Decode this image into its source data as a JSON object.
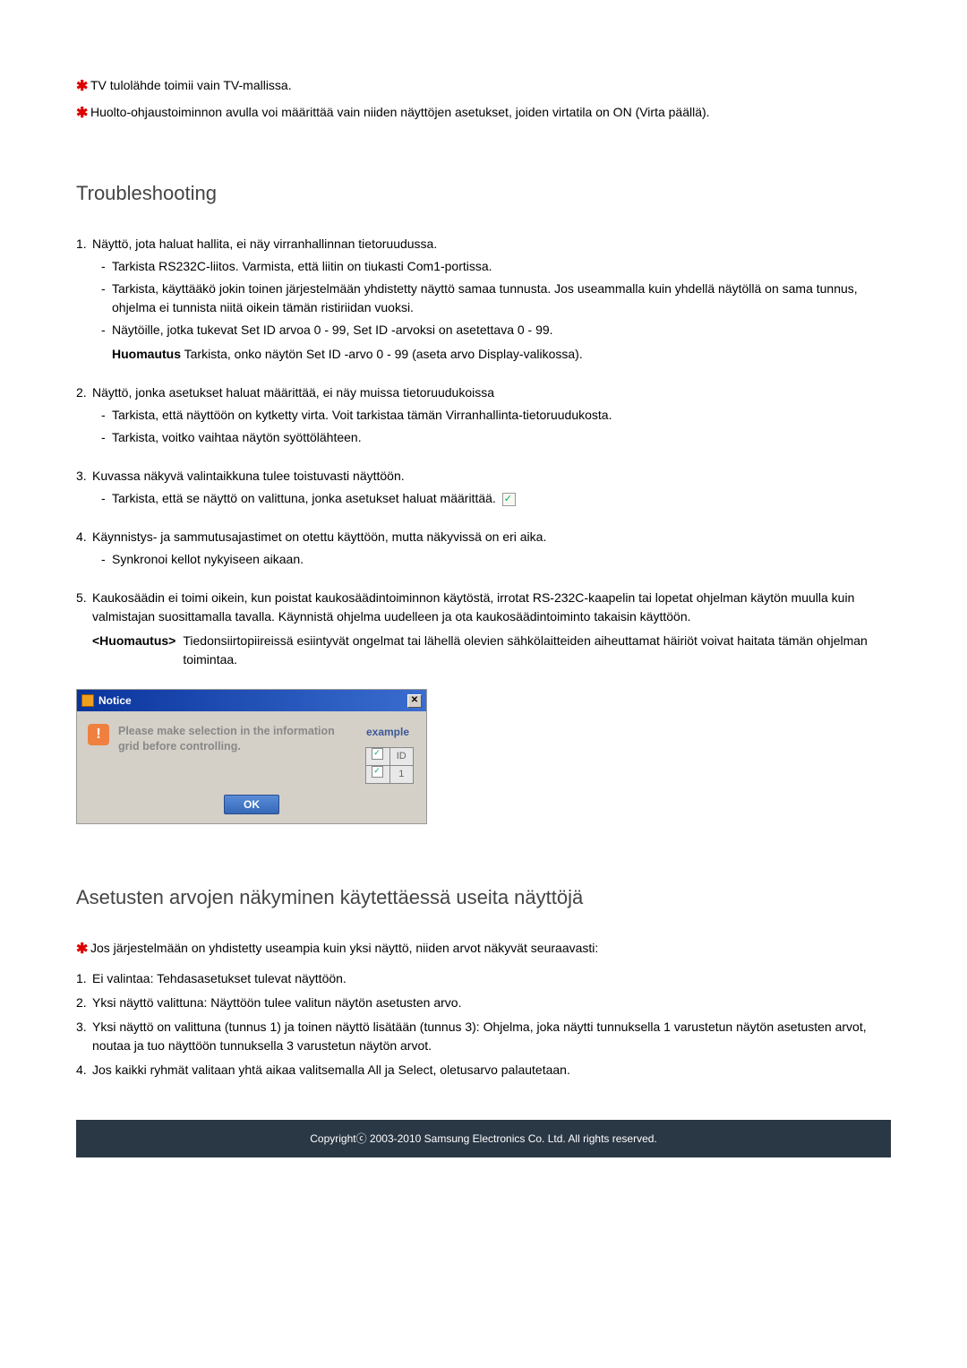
{
  "top_notes": [
    "TV tulolähde toimii vain TV-mallissa.",
    "Huolto-ohjaustoiminnon avulla voi määrittää vain niiden näyttöjen asetukset, joiden virtatila on ON (Virta päällä)."
  ],
  "troubleshooting": {
    "heading": "Troubleshooting",
    "items": [
      {
        "main": "Näyttö, jota haluat hallita, ei näy virranhallinnan tietoruudussa.",
        "subs": [
          "Tarkista RS232C-liitos. Varmista, että liitin on tiukasti Com1-portissa.",
          "Tarkista, käyttääkö jokin toinen järjestelmään yhdistetty näyttö samaa tunnusta. Jos useammalla kuin yhdellä näytöllä on sama tunnus, ohjelma ei tunnista niitä oikein tämän ristiriidan vuoksi.",
          "Näytöille, jotka tukevat Set ID arvoa 0 - 99, Set ID -arvoksi on asetettava 0 - 99."
        ],
        "huom": "Huomautus",
        "huom_text": "Tarkista, onko näytön Set ID -arvo 0 - 99 (aseta arvo Display-valikossa)."
      },
      {
        "main": "Näyttö, jonka asetukset haluat määrittää, ei näy muissa tietoruudukoissa",
        "subs": [
          "Tarkista, että näyttöön on kytketty virta. Voit tarkistaa tämän Virranhallinta-tietoruudukosta.",
          "Tarkista, voitko vaihtaa näytön syöttölähteen."
        ]
      },
      {
        "main": "Kuvassa näkyvä valintaikkuna tulee toistuvasti näyttöön.",
        "subs": [
          "Tarkista, että se näyttö on valittuna, jonka asetukset haluat määrittää."
        ],
        "has_checkbox": true
      },
      {
        "main": "Käynnistys- ja sammutusajastimet on otettu käyttöön, mutta näkyvissä on eri aika.",
        "subs": [
          "Synkronoi kellot nykyiseen aikaan."
        ]
      },
      {
        "main": "Kaukosäädin ei toimi oikein, kun poistat kaukosäädintoiminnon käytöstä, irrotat RS-232C-kaapelin tai lopetat ohjelman käytön muulla kuin valmistajan suosittamalla tavalla. Käynnistä ohjelma uudelleen ja ota kaukosäädintoiminto takaisin käyttöön.",
        "huom": "<Huomautus>",
        "huom_text": "Tiedonsiirtopiireissä esiintyvät ongelmat tai lähellä olevien sähkölaitteiden aiheuttamat häiriöt voivat haitata tämän ohjelman toimintaa."
      }
    ]
  },
  "dialog": {
    "title": "Notice",
    "message": "Please make selection in the information grid before controlling.",
    "example_label": "example",
    "ok": "OK",
    "id_label": "ID",
    "id_value": "1"
  },
  "section3": {
    "heading": "Asetusten arvojen näkyminen käytettäessä useita näyttöjä",
    "note": "Jos järjestelmään on yhdistetty useampia kuin yksi näyttö, niiden arvot näkyvät seuraavasti:",
    "items": [
      "Ei valintaa: Tehdasasetukset tulevat näyttöön.",
      "Yksi näyttö valittuna: Näyttöön tulee valitun näytön asetusten arvo.",
      "Yksi näyttö on valittuna (tunnus 1) ja toinen näyttö lisätään (tunnus 3): Ohjelma, joka näytti tunnuksella 1 varustetun näytön asetusten arvot, noutaa ja tuo näyttöön tunnuksella 3 varustetun näytön arvot.",
      "Jos kaikki ryhmät valitaan yhtä aikaa valitsemalla All ja Select, oletusarvo palautetaan."
    ]
  },
  "footer": "Copyrightⓒ 2003-2010  Samsung Electronics Co. Ltd. All rights reserved."
}
